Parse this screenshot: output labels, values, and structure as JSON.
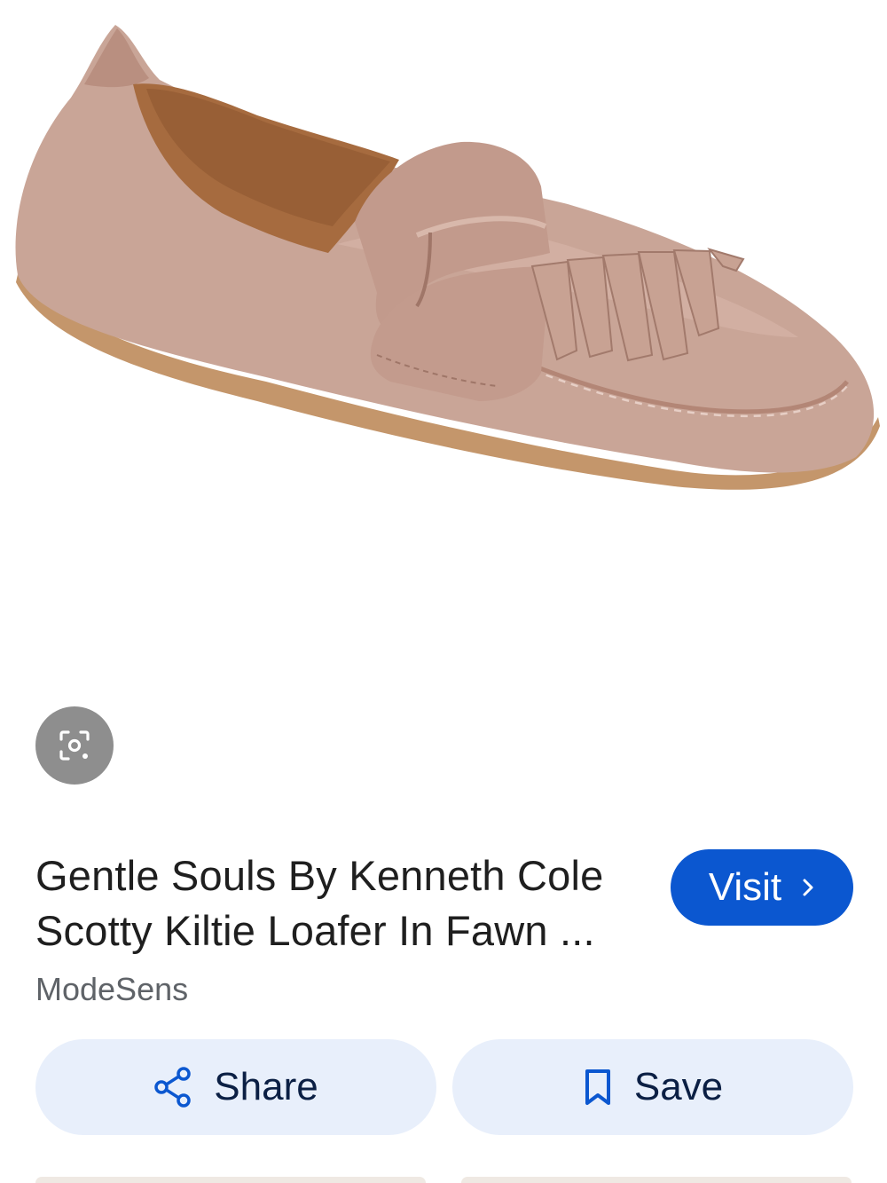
{
  "product": {
    "title_line1": "Gentle Souls By Kenneth Cole",
    "title_line2": "Scotty Kiltie Loafer In Fawn ...",
    "source": "ModeSens",
    "image_subject": "fawn suede kiltie loafer"
  },
  "actions": {
    "visit_label": "Visit",
    "share_label": "Share",
    "save_label": "Save"
  },
  "icons": {
    "lens": "lens-icon",
    "visit": "chevron-right-icon",
    "share": "share-icon",
    "save": "bookmark-icon"
  },
  "colors": {
    "accent": "#0b57d0",
    "button_bg": "#e8effb",
    "suede": "#c9a597",
    "lining": "#a66b3f",
    "lens_bg": "#8e8e8e"
  }
}
